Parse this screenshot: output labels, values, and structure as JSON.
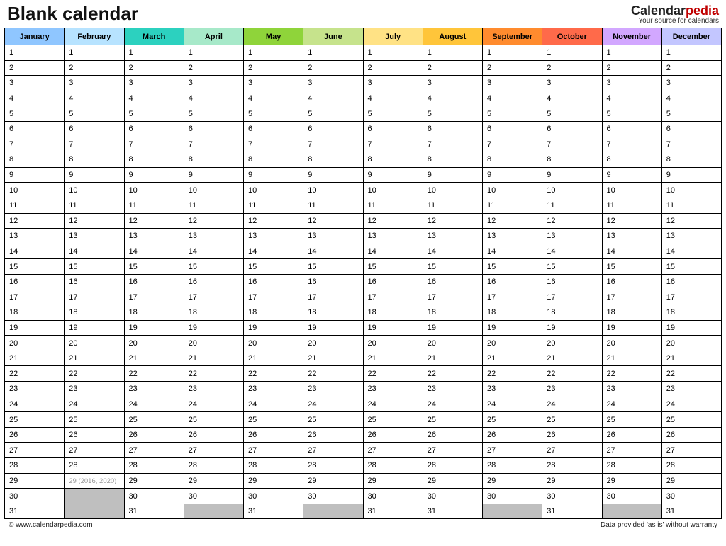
{
  "header": {
    "title": "Blank calendar",
    "brand_main": "Calendar",
    "brand_accent": "pedia",
    "brand_sub": "Your source for calendars"
  },
  "months": [
    {
      "name": "January",
      "days": 31,
      "color": "#8fc6ff"
    },
    {
      "name": "February",
      "days": 28,
      "color": "#b7e3ff",
      "leap_row": 29,
      "leap_note": "29  (2016, 2020)"
    },
    {
      "name": "March",
      "days": 31,
      "color": "#2cd1bf"
    },
    {
      "name": "April",
      "days": 30,
      "color": "#a7e9c9"
    },
    {
      "name": "May",
      "days": 31,
      "color": "#8fd43a"
    },
    {
      "name": "June",
      "days": 30,
      "color": "#c6e38c"
    },
    {
      "name": "July",
      "days": 31,
      "color": "#ffe285"
    },
    {
      "name": "August",
      "days": 31,
      "color": "#ffc53a"
    },
    {
      "name": "September",
      "days": 30,
      "color": "#ff8b2e"
    },
    {
      "name": "October",
      "days": 31,
      "color": "#ff6a4a"
    },
    {
      "name": "November",
      "days": 30,
      "color": "#d2a7ff"
    },
    {
      "name": "December",
      "days": 31,
      "color": "#c3c6ff"
    }
  ],
  "max_rows": 31,
  "footer": {
    "left": "© www.calendarpedia.com",
    "right": "Data provided 'as is' without warranty"
  }
}
